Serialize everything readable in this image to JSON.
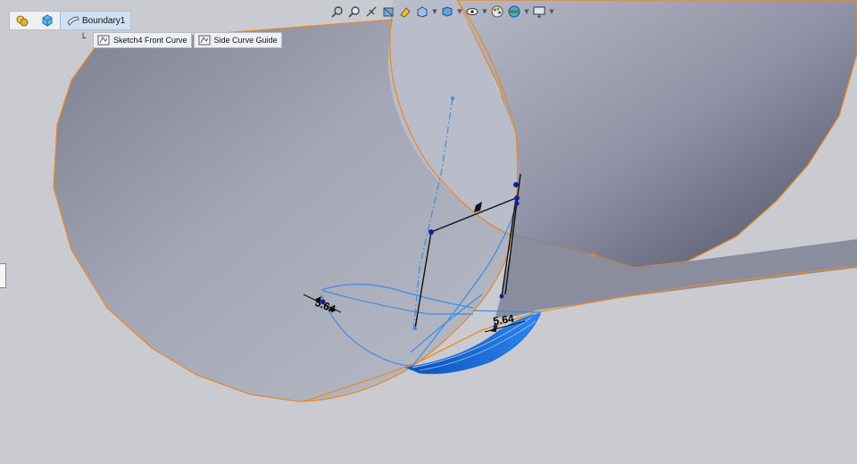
{
  "breadcrumb": {
    "items": [
      {
        "icon": "assembly-icon"
      },
      {
        "icon": "part-icon"
      },
      {
        "icon": "boundary-feature-icon",
        "label": "Boundary1"
      }
    ]
  },
  "selection_chips": [
    {
      "icon": "sketch-icon",
      "label": "Sketch4 Front Curve"
    },
    {
      "icon": "sketch-icon",
      "label": "Side Curve Guide"
    }
  ],
  "heads_up_toolbar": [
    "zoom-to-fit-icon",
    "zoom-to-area-icon",
    "previous-view-icon",
    "section-view-icon",
    "dynamic-annotation-view-icon",
    "view-orientation-icon",
    "display-style-icon",
    "hide-show-items-icon",
    "edit-appearance-icon",
    "apply-scene-icon",
    "view-settings-icon"
  ],
  "dimensions": [
    {
      "label": "5.64"
    },
    {
      "label": "5.64"
    }
  ],
  "colors": {
    "background": "#c9cbd0",
    "surface_edge": "#e8892a",
    "sketch_blue": "#3a8de8",
    "boundary_fill": "#0b55c4"
  }
}
